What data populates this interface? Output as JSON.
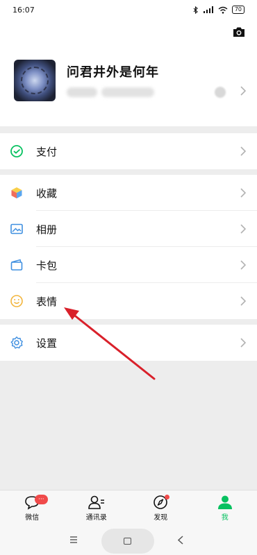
{
  "status": {
    "time": "16:07",
    "battery": "70"
  },
  "profile": {
    "nickname": "问君井外是何年"
  },
  "menu": {
    "pay": "支付",
    "favorites": "收藏",
    "album": "相册",
    "cards": "卡包",
    "stickers": "表情",
    "settings": "设置"
  },
  "tabs": [
    {
      "label": "微信",
      "badge": "···"
    },
    {
      "label": "通讯录"
    },
    {
      "label": "发现"
    },
    {
      "label": "我"
    }
  ],
  "colors": {
    "accent": "#07c160",
    "badge": "#f04a4a",
    "annotation_arrow": "#d9202a"
  }
}
